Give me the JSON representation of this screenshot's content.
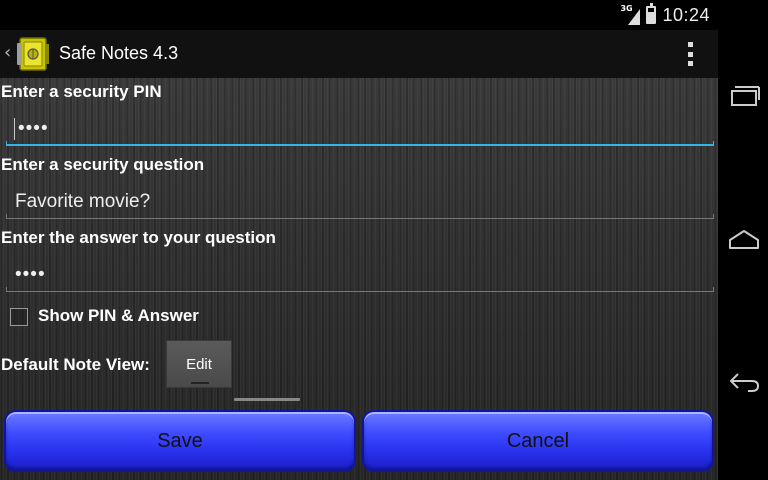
{
  "status_bar": {
    "network_label": "3G",
    "time": "10:24"
  },
  "action_bar": {
    "back_glyph": "‹",
    "title": "Safe Notes 4.3"
  },
  "form": {
    "pin_label": "Enter a security PIN",
    "pin_value": "••••",
    "question_label": "Enter a security question",
    "question_value": "Favorite movie?",
    "answer_label": "Enter the answer to your question",
    "answer_value": "••••",
    "show_label": "Show PIN & Answer",
    "show_checked": false,
    "default_view_label": "Default Note View:",
    "default_view_value": "Edit"
  },
  "buttons": {
    "save": "Save",
    "cancel": "Cancel"
  },
  "icons": {
    "app": "safe-icon",
    "overflow": "overflow-menu-icon",
    "recent": "recent-apps-icon",
    "home": "home-icon",
    "back": "back-icon"
  },
  "colors": {
    "focus_line": "#33b5e5",
    "button_blue": "#2a33f0"
  }
}
